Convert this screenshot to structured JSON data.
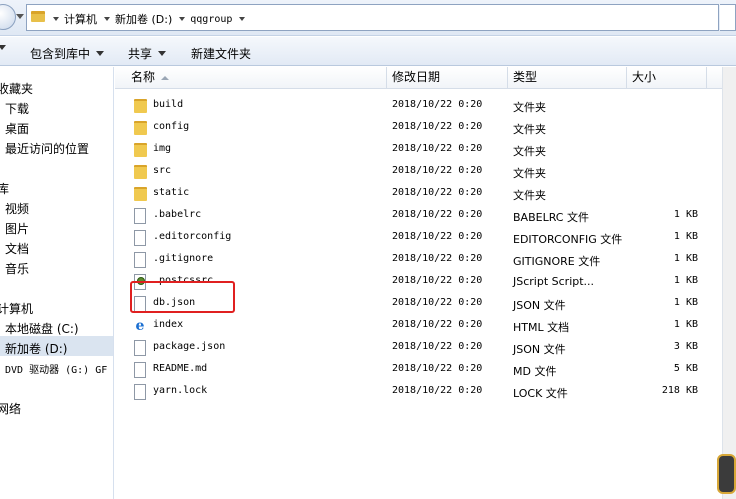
{
  "address": {
    "crumbs": [
      "计算机",
      "新加卷 (D:)",
      "qqgroup"
    ]
  },
  "toolbar": {
    "include_label": "包含到库中",
    "share_label": "共享",
    "new_folder_label": "新建文件夹"
  },
  "sidebar": {
    "favorites": "收藏夹",
    "downloads": "下载",
    "desktop": "桌面",
    "recent": "最近访问的位置",
    "libraries": "库",
    "videos": "视频",
    "pictures": "图片",
    "documents": "文档",
    "music": "音乐",
    "computer": "计算机",
    "local_disk": "本地磁盘 (C:)",
    "new_volume": "新加卷 (D:)",
    "dvd": "DVD 驱动器 (G:) GF",
    "network": "网络"
  },
  "columns": {
    "name": "名称",
    "modified": "修改日期",
    "type": "类型",
    "size": "大小"
  },
  "files": [
    {
      "name": "build",
      "date": "2018/10/22 0:20",
      "type": "文件夹",
      "size": "",
      "icon": "folder-icon"
    },
    {
      "name": "config",
      "date": "2018/10/22 0:20",
      "type": "文件夹",
      "size": "",
      "icon": "folder-icon"
    },
    {
      "name": "img",
      "date": "2018/10/22 0:20",
      "type": "文件夹",
      "size": "",
      "icon": "folder-icon"
    },
    {
      "name": "src",
      "date": "2018/10/22 0:20",
      "type": "文件夹",
      "size": "",
      "icon": "folder-icon"
    },
    {
      "name": "static",
      "date": "2018/10/22 0:20",
      "type": "文件夹",
      "size": "",
      "icon": "folder-icon"
    },
    {
      "name": ".babelrc",
      "date": "2018/10/22 0:20",
      "type": "BABELRC 文件",
      "size": "1 KB",
      "icon": "file-icon"
    },
    {
      "name": ".editorconfig",
      "date": "2018/10/22 0:20",
      "type": "EDITORCONFIG 文件",
      "size": "1 KB",
      "icon": "file-icon"
    },
    {
      "name": ".gitignore",
      "date": "2018/10/22 0:20",
      "type": "GITIGNORE 文件",
      "size": "1 KB",
      "icon": "file-icon"
    },
    {
      "name": ".postcssrc",
      "date": "2018/10/22 0:20",
      "type": "JScript Script...",
      "size": "1 KB",
      "icon": "script-icon"
    },
    {
      "name": "db.json",
      "date": "2018/10/22 0:20",
      "type": "JSON 文件",
      "size": "1 KB",
      "icon": "file-icon"
    },
    {
      "name": "index",
      "date": "2018/10/22 0:20",
      "type": "HTML 文档",
      "size": "1 KB",
      "icon": "ie-icon"
    },
    {
      "name": "package.json",
      "date": "2018/10/22 0:20",
      "type": "JSON 文件",
      "size": "3 KB",
      "icon": "file-icon"
    },
    {
      "name": "README.md",
      "date": "2018/10/22 0:20",
      "type": "MD 文件",
      "size": "5 KB",
      "icon": "file-icon"
    },
    {
      "name": "yarn.lock",
      "date": "2018/10/22 0:20",
      "type": "LOCK 文件",
      "size": "218 KB",
      "icon": "file-icon"
    }
  ],
  "colors": {
    "highlight_border": "#e02020",
    "selected_nav": "#dae4f0"
  }
}
